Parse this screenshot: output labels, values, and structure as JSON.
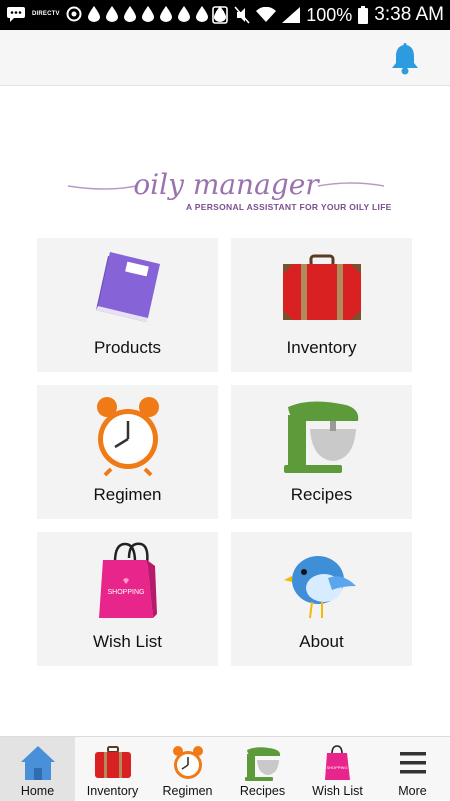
{
  "status_bar": {
    "battery": "100%",
    "time": "3:38 AM",
    "carrier_label": "DIRECTV"
  },
  "app": {
    "logo": {
      "script": "oily manager",
      "tagline": "A PERSONAL ASSISTANT  FOR YOUR  OILY LIFE"
    },
    "colors": {
      "accent_blue": "#2d9be0",
      "logo_purple": "#9b72b0",
      "tile_bg": "#f3f3f3"
    }
  },
  "grid": {
    "tiles": [
      {
        "label": "Products",
        "icon": "book-icon"
      },
      {
        "label": "Inventory",
        "icon": "suitcase-icon"
      },
      {
        "label": "Regimen",
        "icon": "alarm-clock-icon"
      },
      {
        "label": "Recipes",
        "icon": "stand-mixer-icon"
      },
      {
        "label": "Wish List",
        "icon": "shopping-bag-icon"
      },
      {
        "label": "About",
        "icon": "bird-icon"
      }
    ]
  },
  "tabbar": {
    "items": [
      {
        "label": "Home",
        "icon": "home-icon",
        "active": true
      },
      {
        "label": "Inventory",
        "icon": "suitcase-icon",
        "active": false
      },
      {
        "label": "Regimen",
        "icon": "alarm-clock-icon",
        "active": false
      },
      {
        "label": "Recipes",
        "icon": "stand-mixer-icon",
        "active": false
      },
      {
        "label": "Wish List",
        "icon": "shopping-bag-icon",
        "active": false
      },
      {
        "label": "More",
        "icon": "menu-icon",
        "active": false
      }
    ]
  }
}
